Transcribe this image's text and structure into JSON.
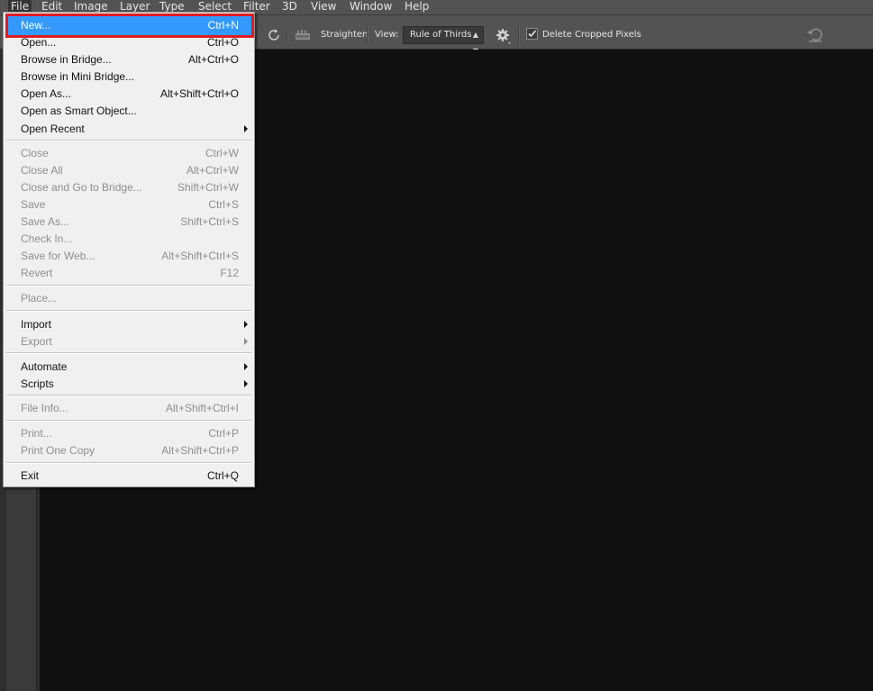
{
  "menubar": {
    "items": [
      "File",
      "Edit",
      "Image",
      "Layer",
      "Type",
      "Select",
      "Filter",
      "3D",
      "View",
      "Window",
      "Help"
    ],
    "active": "File"
  },
  "options_bar": {
    "straighten_label": "Straighten",
    "view_label": "View:",
    "view_value": "Rule of Thirds",
    "delete_cropped_label": "Delete Cropped Pixels",
    "delete_cropped_checked": true
  },
  "file_menu": {
    "items": [
      {
        "label": "New...",
        "shortcut": "Ctrl+N",
        "enabled": true,
        "highlighted": true
      },
      {
        "label": "Open...",
        "shortcut": "Ctrl+O",
        "enabled": true
      },
      {
        "label": "Browse in Bridge...",
        "shortcut": "Alt+Ctrl+O",
        "enabled": true
      },
      {
        "label": "Browse in Mini Bridge...",
        "shortcut": "",
        "enabled": true
      },
      {
        "label": "Open As...",
        "shortcut": "Alt+Shift+Ctrl+O",
        "enabled": true
      },
      {
        "label": "Open as Smart Object...",
        "shortcut": "",
        "enabled": true
      },
      {
        "label": "Open Recent",
        "shortcut": "",
        "enabled": true,
        "submenu": true
      },
      {
        "label": "Close",
        "shortcut": "Ctrl+W",
        "enabled": false
      },
      {
        "label": "Close All",
        "shortcut": "Alt+Ctrl+W",
        "enabled": false
      },
      {
        "label": "Close and Go to Bridge...",
        "shortcut": "Shift+Ctrl+W",
        "enabled": false
      },
      {
        "label": "Save",
        "shortcut": "Ctrl+S",
        "enabled": false
      },
      {
        "label": "Save As...",
        "shortcut": "Shift+Ctrl+S",
        "enabled": false
      },
      {
        "label": "Check In...",
        "shortcut": "",
        "enabled": false
      },
      {
        "label": "Save for Web...",
        "shortcut": "Alt+Shift+Ctrl+S",
        "enabled": false
      },
      {
        "label": "Revert",
        "shortcut": "F12",
        "enabled": false
      },
      {
        "label": "Place...",
        "shortcut": "",
        "enabled": false
      },
      {
        "label": "Import",
        "shortcut": "",
        "enabled": true,
        "submenu": true
      },
      {
        "label": "Export",
        "shortcut": "",
        "enabled": false,
        "submenu": true
      },
      {
        "label": "Automate",
        "shortcut": "",
        "enabled": true,
        "submenu": true
      },
      {
        "label": "Scripts",
        "shortcut": "",
        "enabled": true,
        "submenu": true
      },
      {
        "label": "File Info...",
        "shortcut": "Alt+Shift+Ctrl+I",
        "enabled": false
      },
      {
        "label": "Print...",
        "shortcut": "Ctrl+P",
        "enabled": false
      },
      {
        "label": "Print One Copy",
        "shortcut": "Alt+Shift+Ctrl+P",
        "enabled": false
      },
      {
        "label": "Exit",
        "shortcut": "Ctrl+Q",
        "enabled": true
      }
    ]
  },
  "colors": {
    "highlight": "#3399ff",
    "annotation_box": "#e01b24",
    "menu_bg": "#f0f0f0",
    "chrome": "#535353",
    "canvas": "#101010"
  }
}
